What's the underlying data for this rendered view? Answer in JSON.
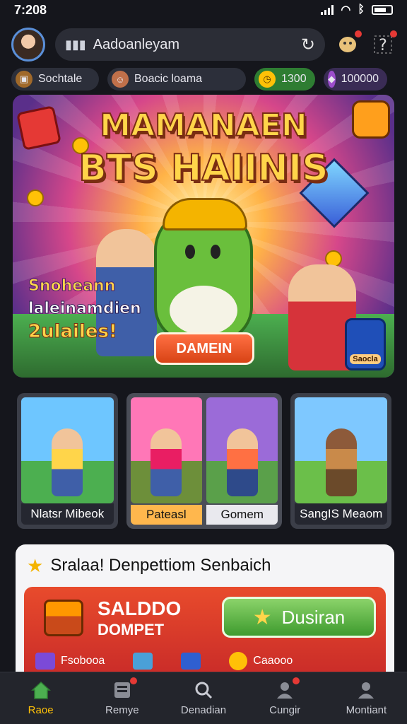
{
  "status": {
    "time": "7:208"
  },
  "topbar": {
    "search_text": "Aadoanleyam"
  },
  "currencies": [
    {
      "label": "Sochtale"
    },
    {
      "label": "Boacic loama"
    },
    {
      "label": "1300"
    },
    {
      "label": "100000"
    }
  ],
  "hero": {
    "title_line1": "MAMANAEN",
    "title_line2": "BTS HAIINIS",
    "side_line1": "Snoheann",
    "side_line2": "laleinamdien",
    "side_line3": "2ulailes!",
    "button_label": "DAMEIN",
    "badge_label": "Saocla"
  },
  "cards": [
    {
      "label": "Nlatsr Mibeok"
    },
    {
      "label": "Pateasl"
    },
    {
      "label": "Gomem"
    },
    {
      "label": "SangIS Meaom"
    }
  ],
  "panel": {
    "heading": "Sralaa! Denpettiom Senbaich",
    "wallet_title_1": "SALDDO",
    "wallet_title_2": "DOMPET",
    "wallet_button": "Dusiran",
    "items": [
      {
        "label": "Fsobooa"
      },
      {
        "label": ""
      },
      {
        "label": ""
      },
      {
        "label": "Caaooo"
      }
    ]
  },
  "tabs": [
    {
      "label": "Raoe",
      "icon": "home-icon"
    },
    {
      "label": "Remye",
      "icon": "news-icon"
    },
    {
      "label": "Denadian",
      "icon": "search-icon"
    },
    {
      "label": "Cungir",
      "icon": "friends-icon"
    },
    {
      "label": "Montiant",
      "icon": "profile-icon"
    }
  ],
  "colors": {
    "accent": "#ffc107",
    "primary_red": "#e84b2c",
    "green_button": "#3e9b2e"
  }
}
